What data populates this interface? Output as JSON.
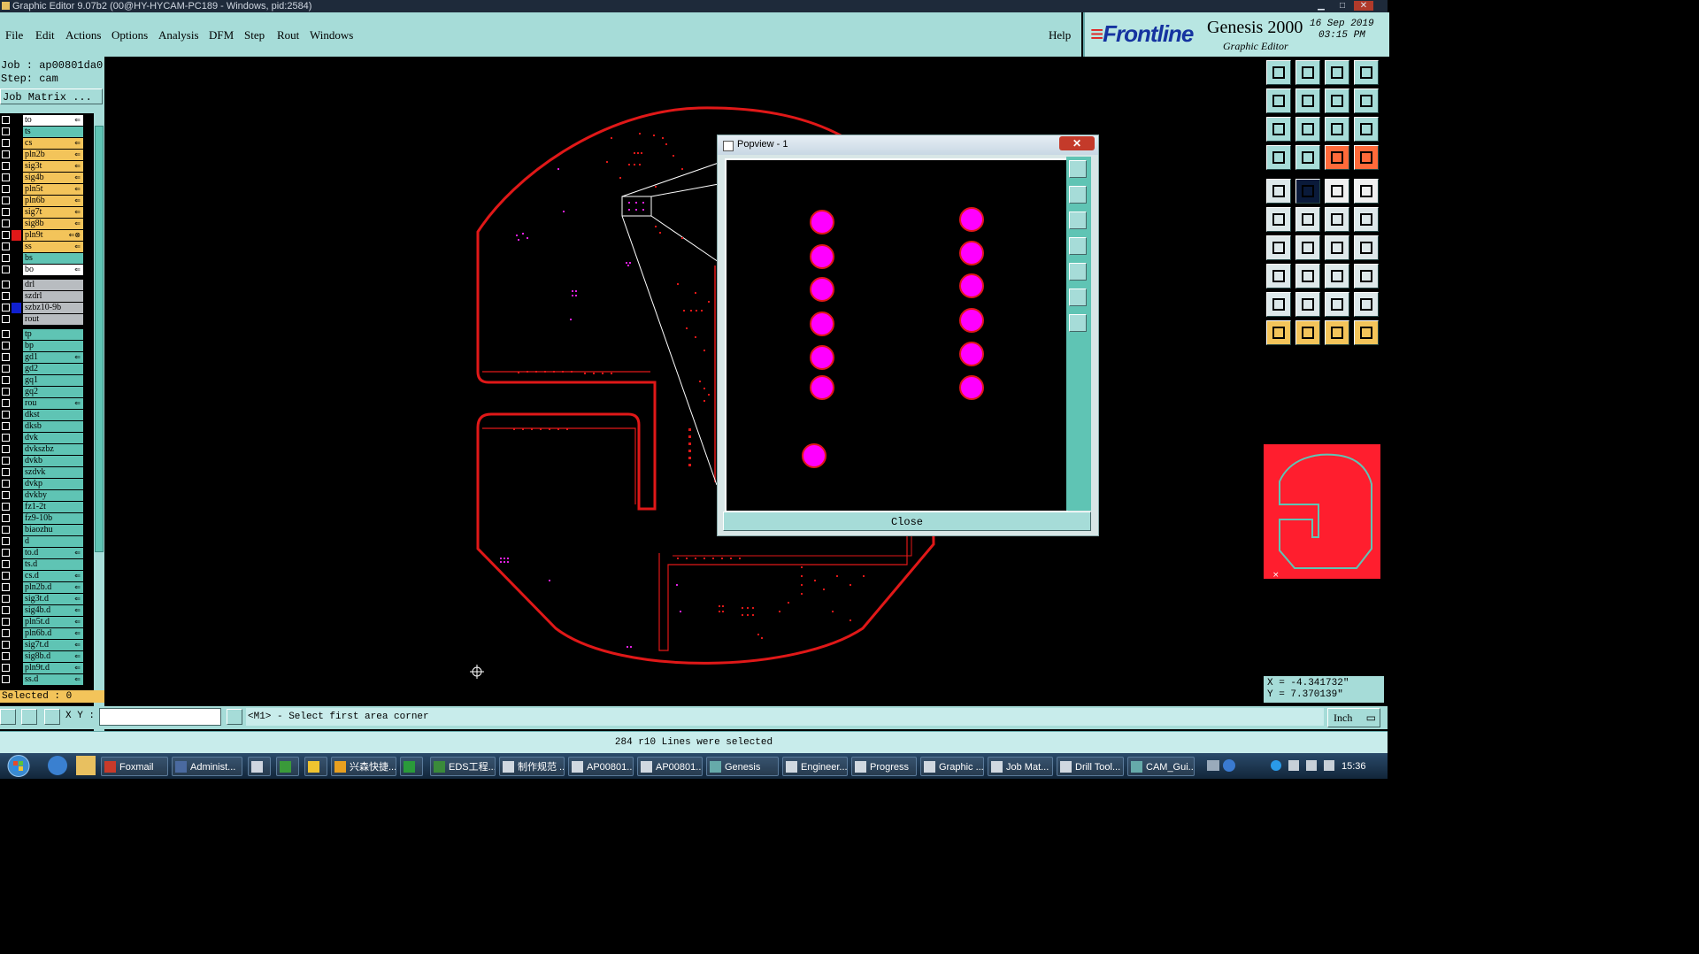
{
  "window": {
    "title": "Graphic Editor 9.07b2 (00@HY-HYCAM-PC189 - Windows, pid:2584)"
  },
  "menu": {
    "items": [
      "File",
      "Edit",
      "Actions",
      "Options",
      "Analysis",
      "DFM",
      "Step",
      "Rout",
      "Windows"
    ],
    "help": "Help"
  },
  "brand": {
    "logo": "Frontline",
    "product": "Genesis 2000",
    "subtitle": "Graphic Editor",
    "date": "16 Sep 2019",
    "time": "03:15 PM"
  },
  "job": {
    "job": "Job : ap00801da0",
    "step": "Step: cam",
    "matrix_button": "Job Matrix ..."
  },
  "layers": [
    {
      "name": "to",
      "color": "#ffffff",
      "sw": "#000000",
      "mk": "⇐"
    },
    {
      "name": "ts",
      "color": "#5fc4b4",
      "sw": "#000000",
      "mk": ""
    },
    {
      "name": "cs",
      "color": "#f3c45a",
      "sw": "#000000",
      "mk": "⇐"
    },
    {
      "name": "pln2b",
      "color": "#f3c45a",
      "sw": "#000000",
      "mk": "⇐"
    },
    {
      "name": "sig3t",
      "color": "#f3c45a",
      "sw": "#000000",
      "mk": "⇐"
    },
    {
      "name": "sig4b",
      "color": "#f3c45a",
      "sw": "#000000",
      "mk": "⇐"
    },
    {
      "name": "pln5t",
      "color": "#f3c45a",
      "sw": "#000000",
      "mk": "⇐"
    },
    {
      "name": "pln6b",
      "color": "#f3c45a",
      "sw": "#000000",
      "mk": "⇐"
    },
    {
      "name": "sig7t",
      "color": "#f3c45a",
      "sw": "#000000",
      "mk": "⇐"
    },
    {
      "name": "sig8b",
      "color": "#f3c45a",
      "sw": "#000000",
      "mk": "⇐"
    },
    {
      "name": "pln9t",
      "color": "#f3c45a",
      "sw": "#e01818",
      "mk": "⇐⊗"
    },
    {
      "name": "ss",
      "color": "#f3c45a",
      "sw": "#000000",
      "mk": "⇐"
    },
    {
      "name": "bs",
      "color": "#5fc4b4",
      "sw": "#000000",
      "mk": ""
    },
    {
      "name": "bo",
      "color": "#ffffff",
      "sw": "#000000",
      "mk": "⇐"
    },
    {
      "name": "drl",
      "color": "#b8bcc0",
      "sw": "#000000",
      "mk": "",
      "gap": true
    },
    {
      "name": "szdrl",
      "color": "#b8bcc0",
      "sw": "#000000",
      "mk": ""
    },
    {
      "name": "szbz10-9b",
      "color": "#b8bcc0",
      "sw": "#1020d0",
      "mk": ""
    },
    {
      "name": "rout",
      "color": "#b8bcc0",
      "sw": "#000000",
      "mk": ""
    },
    {
      "name": "tp",
      "color": "#5fc4b4",
      "sw": "#000000",
      "mk": "",
      "gap": true
    },
    {
      "name": "bp",
      "color": "#5fc4b4",
      "sw": "#000000",
      "mk": ""
    },
    {
      "name": "gd1",
      "color": "#5fc4b4",
      "sw": "#000000",
      "mk": "⇐"
    },
    {
      "name": "gd2",
      "color": "#5fc4b4",
      "sw": "#000000",
      "mk": ""
    },
    {
      "name": "gq1",
      "color": "#5fc4b4",
      "sw": "#000000",
      "mk": ""
    },
    {
      "name": "gq2",
      "color": "#5fc4b4",
      "sw": "#000000",
      "mk": ""
    },
    {
      "name": "rou",
      "color": "#5fc4b4",
      "sw": "#000000",
      "mk": "⇐"
    },
    {
      "name": "dkst",
      "color": "#5fc4b4",
      "sw": "#000000",
      "mk": ""
    },
    {
      "name": "dksb",
      "color": "#5fc4b4",
      "sw": "#000000",
      "mk": ""
    },
    {
      "name": "dvk",
      "color": "#5fc4b4",
      "sw": "#000000",
      "mk": ""
    },
    {
      "name": "dvkszbz",
      "color": "#5fc4b4",
      "sw": "#000000",
      "mk": ""
    },
    {
      "name": "dvkb",
      "color": "#5fc4b4",
      "sw": "#000000",
      "mk": ""
    },
    {
      "name": "szdvk",
      "color": "#5fc4b4",
      "sw": "#000000",
      "mk": ""
    },
    {
      "name": "dvkp",
      "color": "#5fc4b4",
      "sw": "#000000",
      "mk": ""
    },
    {
      "name": "dvkby",
      "color": "#5fc4b4",
      "sw": "#000000",
      "mk": ""
    },
    {
      "name": "fz1-2t",
      "color": "#5fc4b4",
      "sw": "#000000",
      "mk": ""
    },
    {
      "name": "fz9-10b",
      "color": "#5fc4b4",
      "sw": "#000000",
      "mk": ""
    },
    {
      "name": "biaozhu",
      "color": "#5fc4b4",
      "sw": "#000000",
      "mk": ""
    },
    {
      "name": "d",
      "color": "#5fc4b4",
      "sw": "#000000",
      "mk": ""
    },
    {
      "name": "to.d",
      "color": "#5fc4b4",
      "sw": "#000000",
      "mk": "⇐"
    },
    {
      "name": "ts.d",
      "color": "#5fc4b4",
      "sw": "#000000",
      "mk": ""
    },
    {
      "name": "cs.d",
      "color": "#5fc4b4",
      "sw": "#000000",
      "mk": "⇐"
    },
    {
      "name": "pln2b.d",
      "color": "#5fc4b4",
      "sw": "#000000",
      "mk": "⇐"
    },
    {
      "name": "sig3t.d",
      "color": "#5fc4b4",
      "sw": "#000000",
      "mk": "⇐"
    },
    {
      "name": "sig4b.d",
      "color": "#5fc4b4",
      "sw": "#000000",
      "mk": "⇐"
    },
    {
      "name": "pln5t.d",
      "color": "#5fc4b4",
      "sw": "#000000",
      "mk": "⇐"
    },
    {
      "name": "pln6b.d",
      "color": "#5fc4b4",
      "sw": "#000000",
      "mk": "⇐"
    },
    {
      "name": "sig7t.d",
      "color": "#5fc4b4",
      "sw": "#000000",
      "mk": "⇐"
    },
    {
      "name": "sig8b.d",
      "color": "#5fc4b4",
      "sw": "#000000",
      "mk": "⇐"
    },
    {
      "name": "pln9t.d",
      "color": "#5fc4b4",
      "sw": "#000000",
      "mk": "⇐"
    },
    {
      "name": "ss.d",
      "color": "#5fc4b4",
      "sw": "#000000",
      "mk": "⇐"
    }
  ],
  "selected": "Selected : 0",
  "popview": {
    "title": "Popview - 1",
    "close_label": "Close",
    "close_x": "✕"
  },
  "coords": {
    "x": "X = -4.341732\"",
    "y": "Y = 7.370139\""
  },
  "command": {
    "xy_label": "X Y :",
    "xy_value": "",
    "prompt": "<M1> - Select first area corner",
    "unit": "Inch"
  },
  "status": "284 r10 Lines were selected",
  "taskbar": {
    "tasks": [
      "Foxmail",
      "Administ...",
      "",
      "",
      "",
      "兴森快捷...",
      "",
      "EDS工程...",
      "制作规范 ...",
      "AP00801...",
      "AP00801...",
      "Genesis",
      "Engineer...",
      "Progress",
      "Graphic ...",
      "Job Mat...",
      "Drill Tool...",
      "CAM_Gui..."
    ],
    "clock": "15:36"
  },
  "colors": {
    "accent": "#a6dcd8",
    "board": "#e01818",
    "pad": "#ff00ff",
    "highlight": "#f3c45a"
  }
}
